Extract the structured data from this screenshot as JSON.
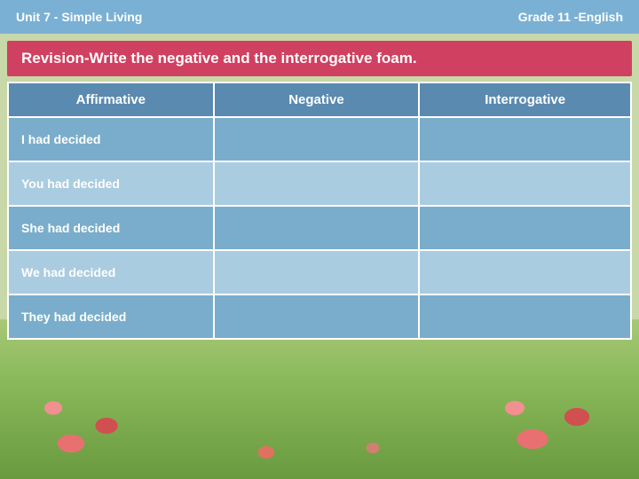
{
  "header": {
    "left": "Unit 7 -  Simple Living",
    "right": "Grade 11  -English"
  },
  "revision": {
    "title": "Revision-Write the negative and the interrogative foam."
  },
  "table": {
    "columns": [
      "Affirmative",
      "Negative",
      "Interrogative"
    ],
    "rows": [
      {
        "affirmative": "I had decided",
        "negative": "",
        "interrogative": ""
      },
      {
        "affirmative": "You had decided",
        "negative": "",
        "interrogative": ""
      },
      {
        "affirmative": "She had decided",
        "negative": "",
        "interrogative": ""
      },
      {
        "affirmative": "We had decided",
        "negative": "",
        "interrogative": ""
      },
      {
        "affirmative": "They had decided",
        "negative": "",
        "interrogative": ""
      }
    ]
  }
}
